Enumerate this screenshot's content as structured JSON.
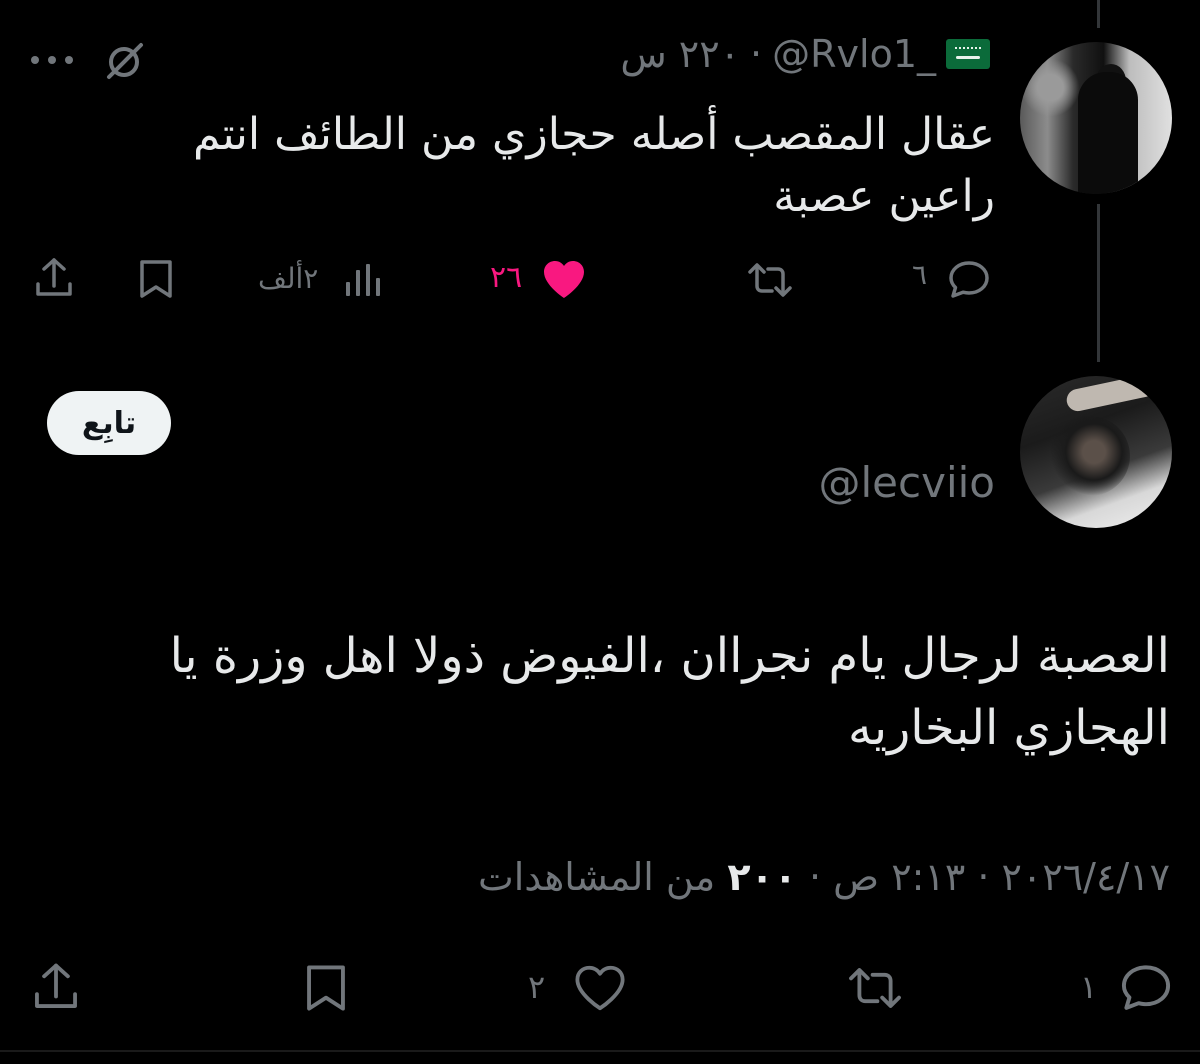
{
  "reply_tweet": {
    "handle_line": "@Rvlo1_",
    "time_text": "٢٢٠ س",
    "text_line1": "عقال المقصب أصله حجازي من الطائف انتم",
    "text_line2": "راعين عصبة",
    "stats": {
      "replies": "٦",
      "likes": "٢٦",
      "views": "٢ألف"
    }
  },
  "main_tweet": {
    "follow_label": "تابِع",
    "handle": "@lecviio",
    "text_line1": "العصبة لرجال يام نجراان ،الفيوض ذولا اهل وزرة يا",
    "text_line2": "الهجازي البخاريه",
    "date_text": "٢٠٢٦/٤/١٧",
    "time_text": "٢:١٣ ص",
    "views_count": "٢٠٠",
    "views_label": "من المشاهدات",
    "stats": {
      "replies": "١",
      "likes": "٢"
    }
  },
  "colors": {
    "background": "#000000",
    "text": "#e7e9ea",
    "muted": "#71767b",
    "like_active": "#f91880"
  },
  "icons": [
    "more-icon",
    "grok-icon",
    "reply-icon",
    "retweet-icon",
    "heart-icon",
    "views-icon",
    "bookmark-icon",
    "share-icon"
  ]
}
